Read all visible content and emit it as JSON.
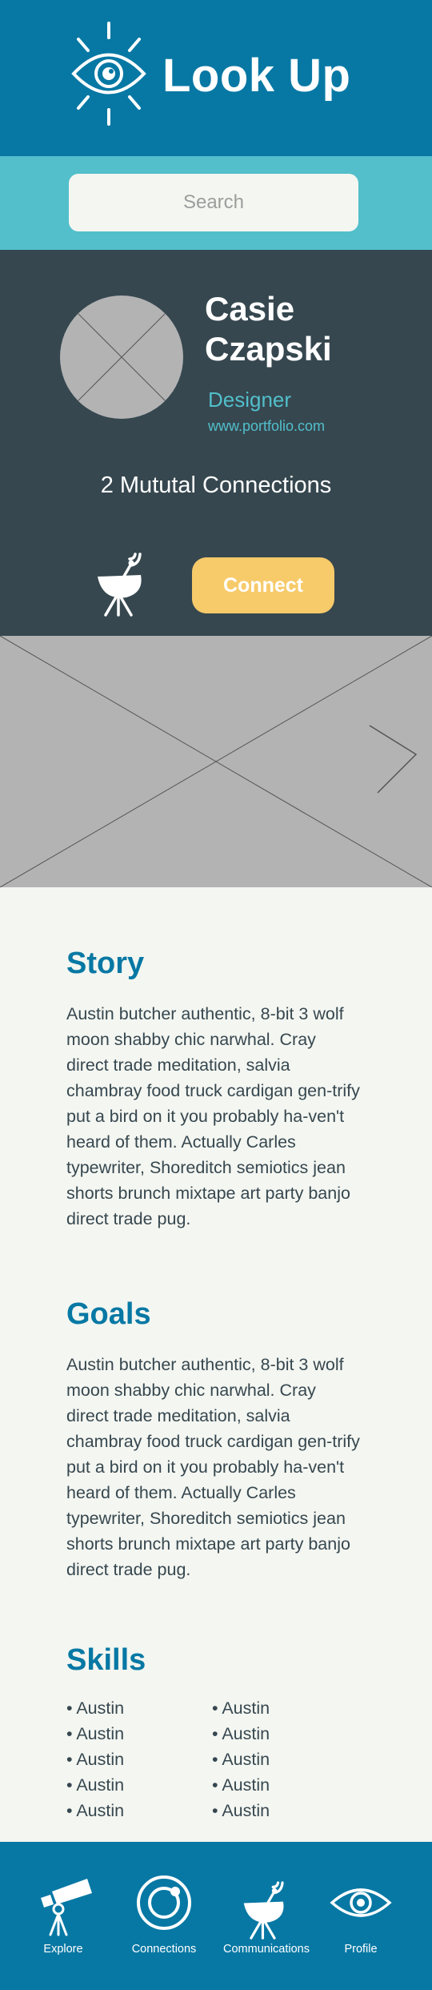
{
  "app": {
    "title": "Look Up",
    "logo_icon": "eye-icon"
  },
  "search": {
    "placeholder": "Search"
  },
  "profile": {
    "first_name": "Casie",
    "last_name": "Czapski",
    "role": "Designer",
    "website": "www.portfolio.com",
    "mutual_connections": "2 Mututal Connections",
    "connect_label": "Connect",
    "action_icon": "satellite-dish-icon"
  },
  "banner": {
    "next_icon": "chevron-right-icon"
  },
  "story": {
    "title": "Story",
    "text": "Austin butcher authentic, 8-bit 3 wolf moon shabby chic narwhal. Cray direct trade meditation, salvia chambray food truck cardigan gen-trify put a bird on it you probably ha-ven't heard of them. Actually Carles typewriter, Shoreditch semiotics jean shorts brunch mixtape art party banjo direct trade pug."
  },
  "goals": {
    "title": "Goals",
    "text": "Austin butcher authentic, 8-bit 3 wolf moon shabby chic narwhal. Cray direct trade meditation, salvia chambray food truck cardigan gen-trify put a bird on it you probably ha-ven't heard of them. Actually Carles typewriter, Shoreditch semiotics jean shorts brunch mixtape art party banjo direct trade pug."
  },
  "skills": {
    "title": "Skills",
    "left": [
      "• Austin",
      "• Austin",
      "• Austin",
      "• Austin",
      "• Austin"
    ],
    "right": [
      "• Austin",
      "• Austin",
      "• Austin",
      "• Austin",
      "• Austin"
    ]
  },
  "nav": [
    {
      "label": "Explore",
      "icon": "telescope-icon"
    },
    {
      "label": "Connections",
      "icon": "connections-ring-icon"
    },
    {
      "label": "Communications",
      "icon": "satellite-dish-icon"
    },
    {
      "label": "Profile",
      "icon": "eye-icon"
    }
  ],
  "colors": {
    "primary": "#0778a4",
    "search_band": "#52bfcb",
    "profile_bg": "#36474f",
    "connect": "#f7ca6a",
    "content_bg": "#f4f6f1",
    "placeholder_gray": "#b3b3b3"
  }
}
